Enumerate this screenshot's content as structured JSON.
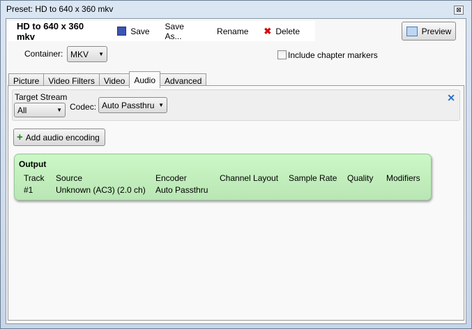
{
  "window": {
    "title": "Preset: HD to 640 x 360 mkv",
    "close": "⊠"
  },
  "toolbar": {
    "preset_name": "HD to 640 x 360 mkv",
    "save": "Save",
    "save_as": "Save As...",
    "rename": "Rename",
    "delete": "Delete",
    "preview": "Preview"
  },
  "container": {
    "label": "Container:",
    "value": "MKV"
  },
  "chapter_markers": {
    "label": "Include chapter markers",
    "checked": false
  },
  "tabs": [
    "Picture",
    "Video Filters",
    "Video",
    "Audio",
    "Advanced"
  ],
  "active_tab": "Audio",
  "stream": {
    "target_label": "Target Stream",
    "target_value": "All",
    "codec_label": "Codec:",
    "codec_value": "Auto Passthru"
  },
  "add_audio": "Add audio encoding",
  "output": {
    "title": "Output",
    "headers": [
      "Track",
      "Source",
      "Encoder",
      "Channel Layout",
      "Sample Rate",
      "Quality",
      "Modifiers"
    ],
    "row": [
      "#1",
      "Unknown (AC3) (2.0 ch)",
      "Auto Passthru",
      "",
      "",
      "",
      ""
    ]
  }
}
